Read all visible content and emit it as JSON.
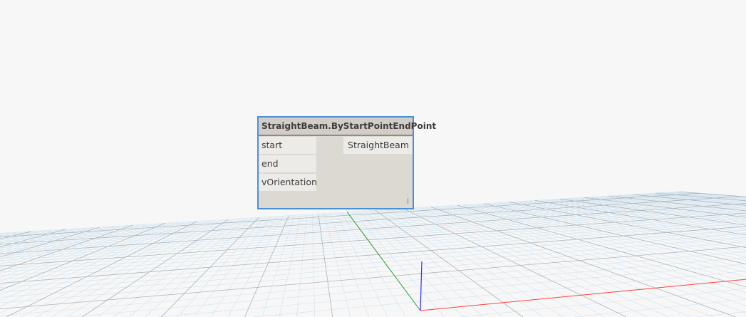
{
  "node": {
    "title": "StraightBeam.ByStartPointEndPoint",
    "inputs": [
      "start",
      "end",
      "vOrientation"
    ],
    "output": "StraightBeam",
    "lacing": "l"
  },
  "colors": {
    "node_border": "#4a90d9",
    "axis_x": "#ff4040",
    "axis_y": "#2e9a2e",
    "axis_z": "#3030ff",
    "grid_minor": "#cfe3f0",
    "grid_major": "#aab4bb"
  }
}
